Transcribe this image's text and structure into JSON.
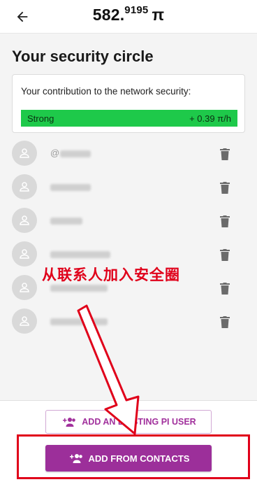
{
  "header": {
    "back_icon": "arrow-left-icon",
    "balance_whole": "582.",
    "balance_fraction": "9195",
    "currency_symbol": "π"
  },
  "page_title": "Your security circle",
  "contribution": {
    "label": "Your contribution to the network security:",
    "strength": "Strong",
    "rate": "+ 0.39 π/h",
    "bar_color": "#1ec94a"
  },
  "members": [
    {
      "name": "@",
      "avatar_icon": "person-icon",
      "delete_icon": "trash-icon"
    },
    {
      "name": "",
      "avatar_icon": "person-icon",
      "delete_icon": "trash-icon"
    },
    {
      "name": "",
      "avatar_icon": "person-icon",
      "delete_icon": "trash-icon"
    },
    {
      "name": "",
      "avatar_icon": "person-icon",
      "delete_icon": "trash-icon"
    },
    {
      "name": "",
      "avatar_icon": "person-icon",
      "delete_icon": "trash-icon"
    },
    {
      "name": "",
      "avatar_icon": "person-icon",
      "delete_icon": "trash-icon"
    }
  ],
  "annotation": {
    "text": "从联系人加入安全圈",
    "color": "#e0001a"
  },
  "actions": {
    "add_existing_label": "ADD AN EXISTING PI USER",
    "add_contacts_label": "ADD FROM CONTACTS",
    "icon": "add-people-icon",
    "accent": "#9c2f9a"
  }
}
